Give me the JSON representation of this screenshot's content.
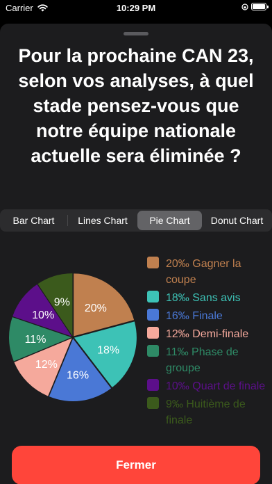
{
  "status_bar": {
    "carrier": "Carrier",
    "time": "10:29 PM"
  },
  "question": "Pour la prochaine CAN 23, selon vos analyses, à quel stade pensez-vous que notre équipe nationale actuelle sera éliminée ?",
  "tabs": [
    {
      "label": "Bar Chart",
      "selected": false
    },
    {
      "label": "Lines Chart",
      "selected": false
    },
    {
      "label": "Pie Chart",
      "selected": true
    },
    {
      "label": "Donut Chart",
      "selected": false
    }
  ],
  "legend": [
    {
      "text": "20‰ Gagner la coupe",
      "color": "#c0804f"
    },
    {
      "text": "18‰ Sans avis",
      "color": "#3dc2b6"
    },
    {
      "text": "16‰ Finale",
      "color": "#4a78d6"
    },
    {
      "text": "12‰ Demi-finale",
      "color": "#f5a99c"
    },
    {
      "text": "11‰ Phase de groupe",
      "color": "#2e8a66"
    },
    {
      "text": "10‰ Quart de finale",
      "color": "#5c0f8a"
    },
    {
      "text": "9‰ Huitième de finale",
      "color": "#3b5a1c"
    }
  ],
  "chart_data": {
    "type": "pie",
    "categories": [
      "Gagner la coupe",
      "Sans avis",
      "Finale",
      "Demi-finale",
      "Phase de groupe",
      "Quart de finale",
      "Huitième de finale"
    ],
    "values": [
      20,
      18,
      16,
      12,
      11,
      10,
      9
    ],
    "slice_labels": [
      "20%",
      "18%",
      "16%",
      "12%",
      "11%",
      "10%",
      "9%"
    ],
    "colors": [
      "#c0804f",
      "#3dc2b6",
      "#4a78d6",
      "#f5a99c",
      "#2e8a66",
      "#5c0f8a",
      "#3b5a1c"
    ],
    "legend_position": "right"
  },
  "close_label": "Fermer"
}
